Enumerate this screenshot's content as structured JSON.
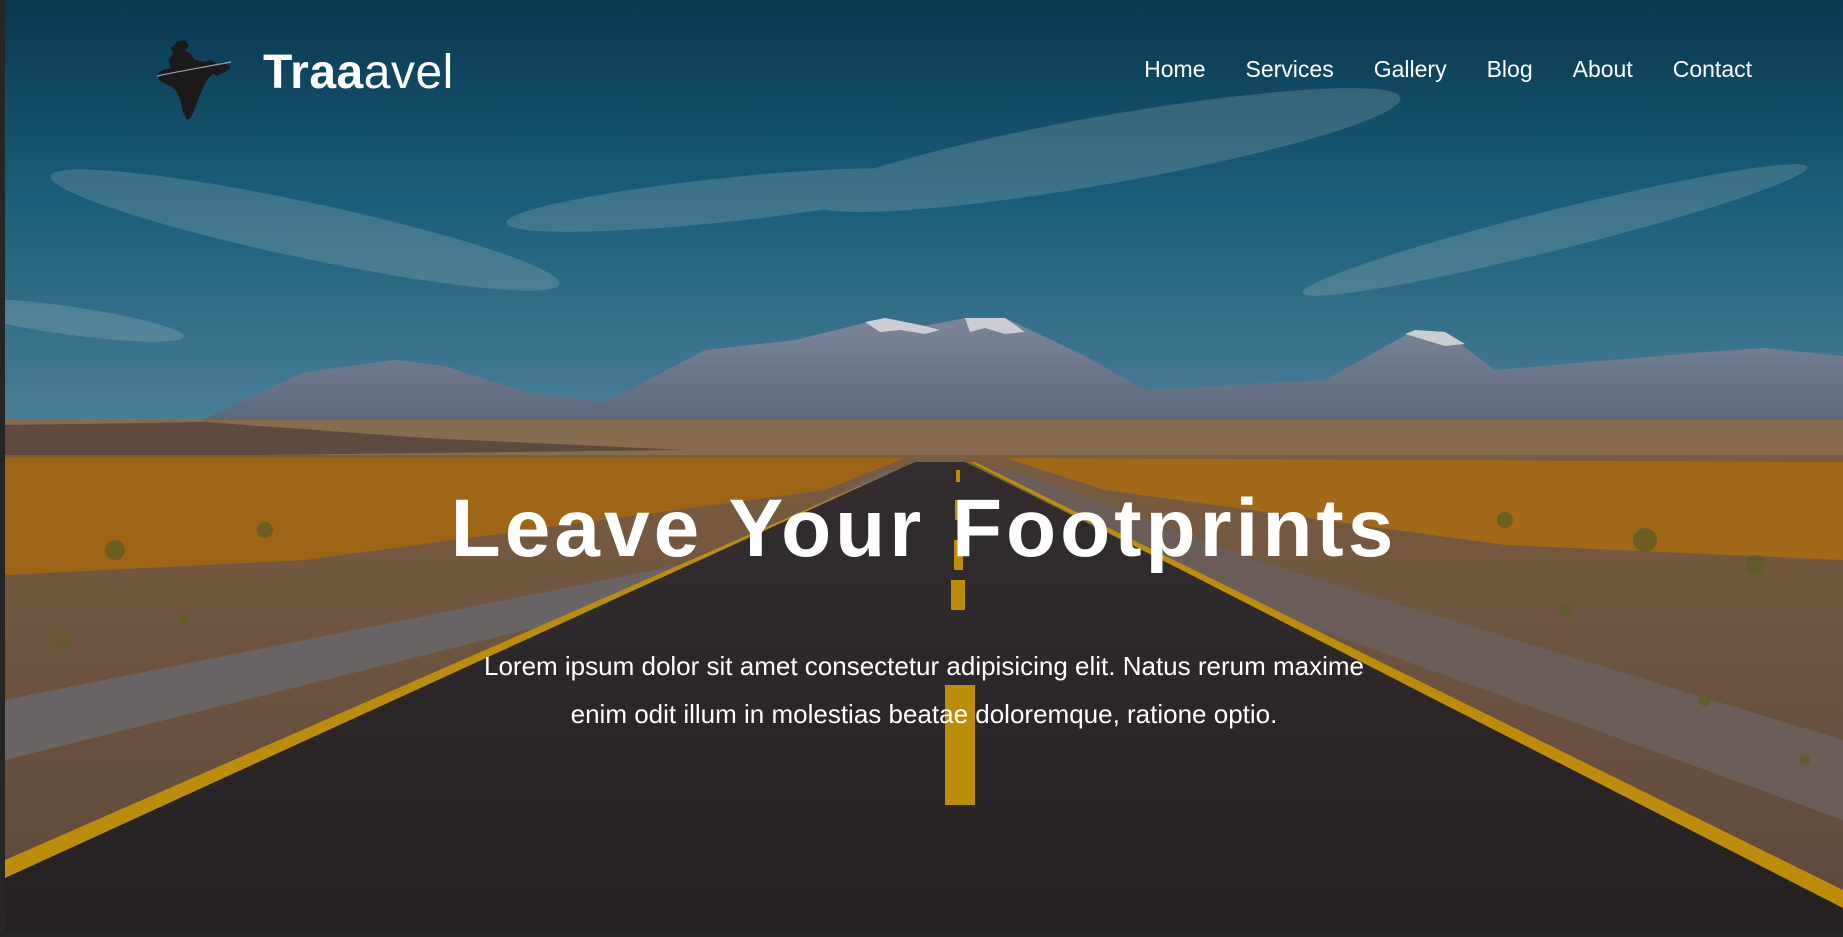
{
  "brand": {
    "name_bold": "Traa",
    "name_light": "avel",
    "logo_icon": "india-map-icon"
  },
  "nav": {
    "items": [
      {
        "label": "Home"
      },
      {
        "label": "Services"
      },
      {
        "label": "Gallery"
      },
      {
        "label": "Blog"
      },
      {
        "label": "About"
      },
      {
        "label": "Contact"
      }
    ]
  },
  "hero": {
    "title": "Leave Your Footprints",
    "subtitle": "Lorem ipsum dolor sit amet consectetur adipisicing elit. Natus rerum maxime enim odit illum in molestias beatae doloremque, ratione optio.",
    "background_scene": "desert-road-mountains",
    "colors": {
      "sky_top": "#0d4a66",
      "sky_bottom": "#3a7f9c",
      "road": "#2f2b2c",
      "road_lines": "#d6a10c",
      "grass": "#b8761a",
      "text": "#ffffff"
    }
  }
}
